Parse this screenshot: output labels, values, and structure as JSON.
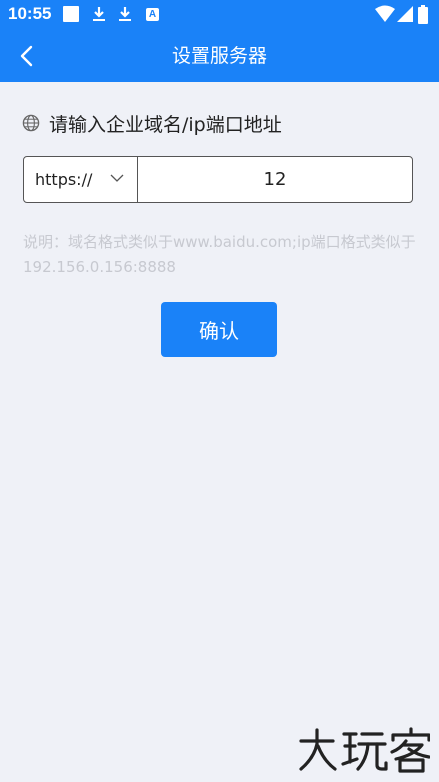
{
  "status_bar": {
    "time": "10:55",
    "notification_icons": [
      "notification-square-icon",
      "download-icon",
      "download-icon",
      "a-badge-icon"
    ],
    "system_icons": [
      "wifi-icon",
      "signal-icon",
      "battery-icon"
    ],
    "a_badge_text": "A"
  },
  "navbar": {
    "title": "设置服务器",
    "back_icon": "chevron-left-icon"
  },
  "form": {
    "prompt_icon": "globe-icon",
    "prompt": "请输入企业域名/ip端口地址",
    "protocol_value": "https://",
    "server_value": "12",
    "hint": "说明：域名格式类似于www.baidu.com;ip端口格式类似于192.156.0.156:8888",
    "confirm_label": "确认"
  },
  "watermark": {
    "text": "大玩客"
  },
  "colors": {
    "accent": "#1a82f8",
    "background": "#eff1f7",
    "hint_text": "#c7c9d0"
  }
}
